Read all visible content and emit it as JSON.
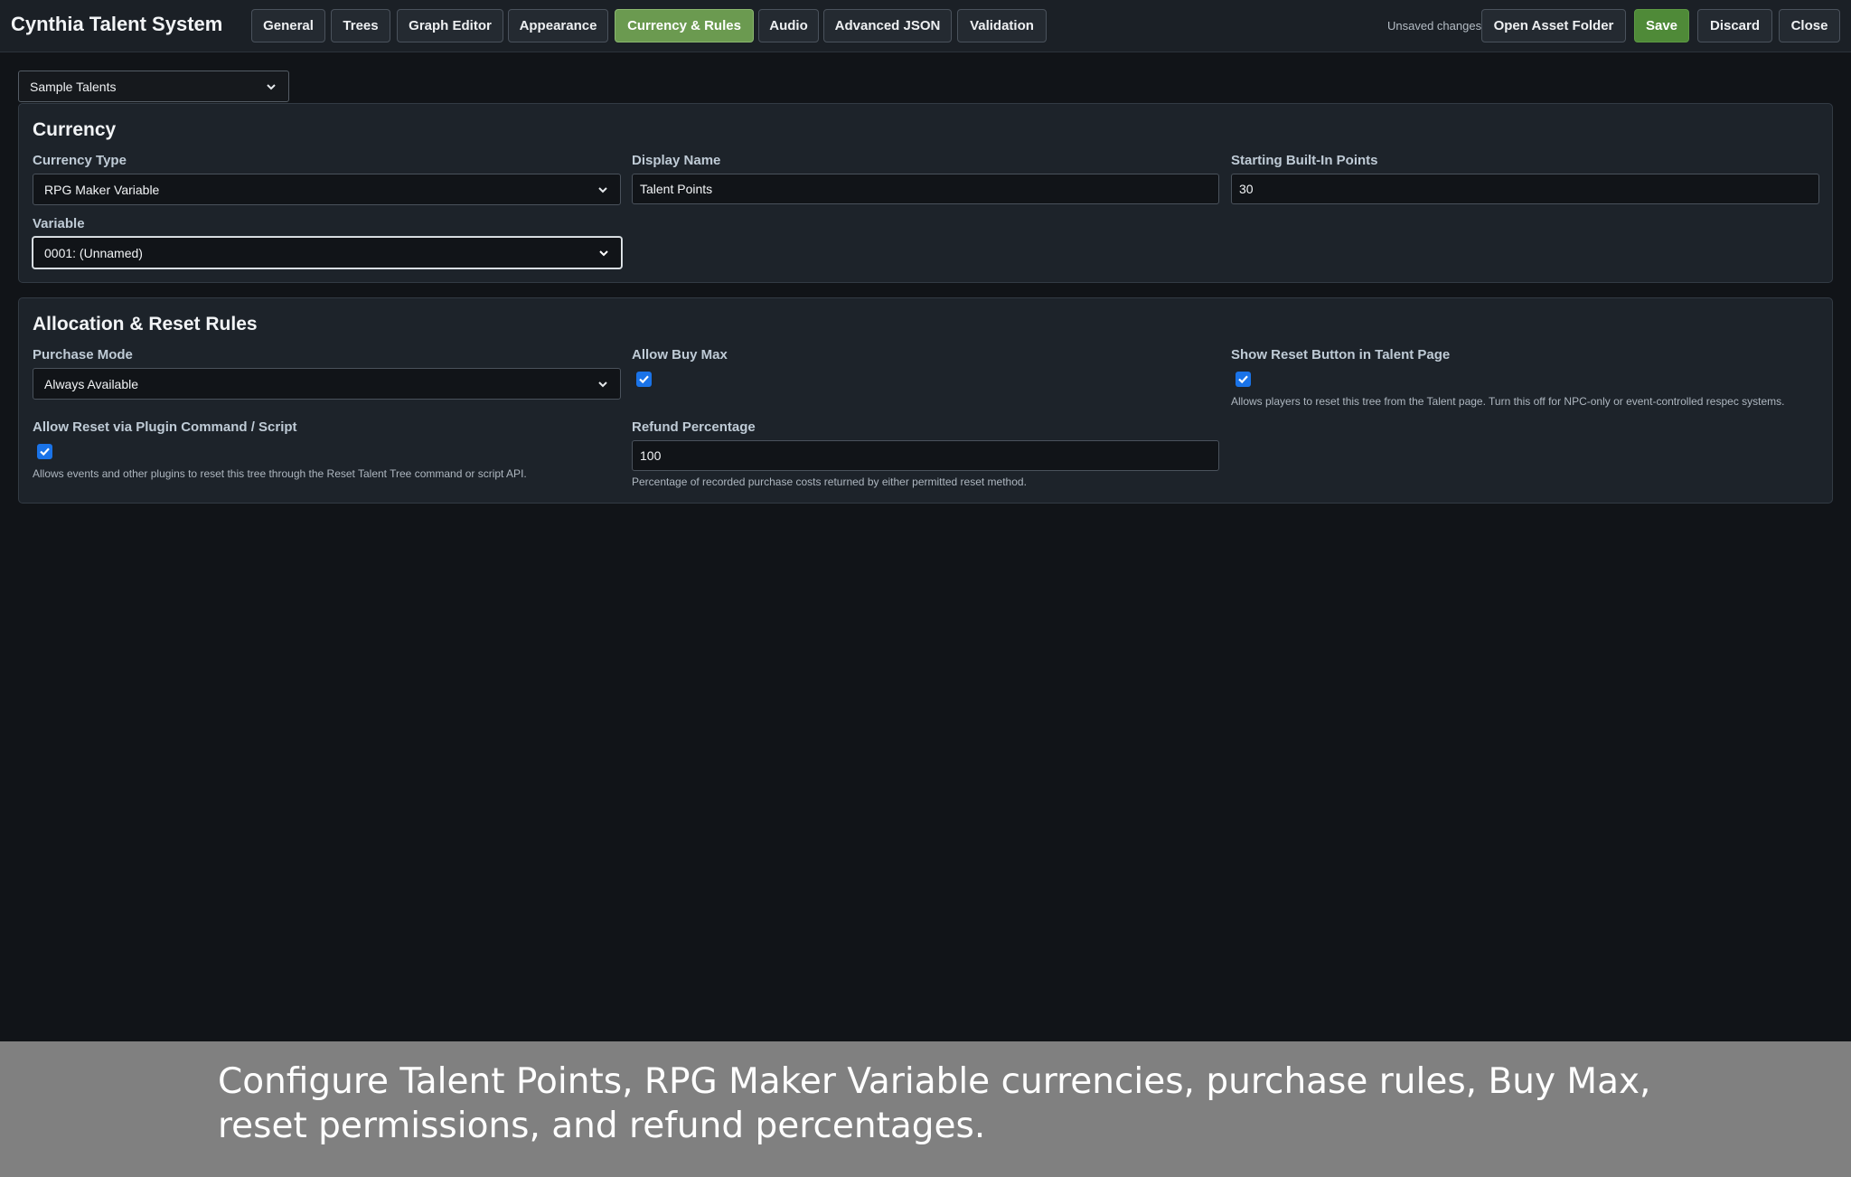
{
  "app": {
    "title": "Cynthia Talent System"
  },
  "tabs": [
    {
      "label": "General",
      "active": false
    },
    {
      "label": "Trees",
      "active": false
    },
    {
      "label": "Graph Editor",
      "active": false
    },
    {
      "label": "Appearance",
      "active": false
    },
    {
      "label": "Currency & Rules",
      "active": true
    },
    {
      "label": "Audio",
      "active": false
    },
    {
      "label": "Advanced JSON",
      "active": false
    },
    {
      "label": "Validation",
      "active": false
    }
  ],
  "toolbar": {
    "status": "Unsaved changes",
    "open_asset_folder": "Open Asset Folder",
    "save": "Save",
    "discard": "Discard",
    "close": "Close"
  },
  "project": {
    "selected": "Sample Talents"
  },
  "currency": {
    "title": "Currency",
    "type": {
      "label": "Currency Type",
      "value": "RPG Maker Variable"
    },
    "display_name": {
      "label": "Display Name",
      "value": "Talent Points"
    },
    "starting_points": {
      "label": "Starting Built-In Points",
      "value": "30"
    },
    "variable": {
      "label": "Variable",
      "value": "0001: (Unnamed)"
    }
  },
  "rules": {
    "title": "Allocation & Reset Rules",
    "purchase_mode": {
      "label": "Purchase Mode",
      "value": "Always Available"
    },
    "allow_buy_max": {
      "label": "Allow Buy Max",
      "checked": true
    },
    "show_reset": {
      "label": "Show Reset Button in Talent Page",
      "checked": true,
      "help": "Allows players to reset this tree from the Talent page. Turn this off for NPC-only or event-controlled respec systems."
    },
    "allow_reset_script": {
      "label": "Allow Reset via Plugin Command / Script",
      "checked": true,
      "help": "Allows events and other plugins to reset this tree through the Reset Talent Tree command or script API."
    },
    "refund": {
      "label": "Refund Percentage",
      "value": "100",
      "help": "Percentage of recorded purchase costs returned by either permitted reset method."
    }
  },
  "caption": "Configure Talent Points, RPG Maker Variable currencies, purchase rules, Buy Max, reset permissions, and refund percentages.",
  "colors": {
    "background": "#111418",
    "panel": "#1d232a",
    "active_tab": "#6b9a50",
    "save_button": "#4f8a38",
    "checkbox": "#1a73e8",
    "caption_band": "#808080"
  }
}
